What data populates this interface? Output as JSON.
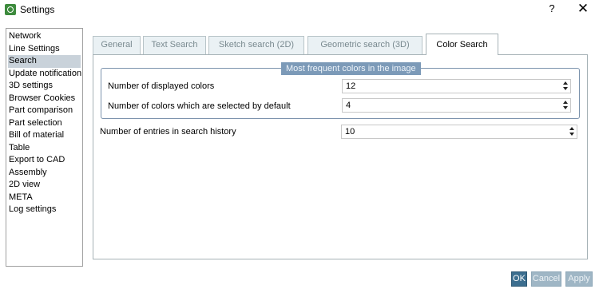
{
  "window": {
    "title": "Settings",
    "help_label": "?",
    "close_label": "✕"
  },
  "sidebar": {
    "items": [
      {
        "label": "Network"
      },
      {
        "label": "Line Settings"
      },
      {
        "label": "Search",
        "selected": true
      },
      {
        "label": "Update notification"
      },
      {
        "label": "3D settings"
      },
      {
        "label": "Browser Cookies"
      },
      {
        "label": "Part comparison"
      },
      {
        "label": "Part selection"
      },
      {
        "label": "Bill of material"
      },
      {
        "label": "Table"
      },
      {
        "label": "Export to CAD"
      },
      {
        "label": "Assembly"
      },
      {
        "label": "2D view"
      },
      {
        "label": "META"
      },
      {
        "label": "Log settings"
      }
    ]
  },
  "tabs": [
    {
      "label": "General"
    },
    {
      "label": "Text Search"
    },
    {
      "label": "Sketch search (2D)"
    },
    {
      "label": "Geometric search (3D)"
    },
    {
      "label": "Color Search",
      "active": true
    }
  ],
  "color_search": {
    "group_title": "Most frequent colors in the image",
    "displayed_colors": {
      "label": "Number of displayed colors",
      "value": "12"
    },
    "selected_by_default": {
      "label": "Number of colors which are selected by default",
      "value": "4"
    },
    "history_entries": {
      "label": "Number of entries in search history",
      "value": "10"
    }
  },
  "buttons": {
    "ok": "OK",
    "cancel": "Cancel",
    "apply": "Apply"
  },
  "colors": {
    "accent": "#3c6e8f",
    "group_border": "#7c93ad",
    "group_title_bg": "#7c9ab8",
    "selected_item_bg": "#c9d2da",
    "disabled_button": "#9fb6c5"
  }
}
